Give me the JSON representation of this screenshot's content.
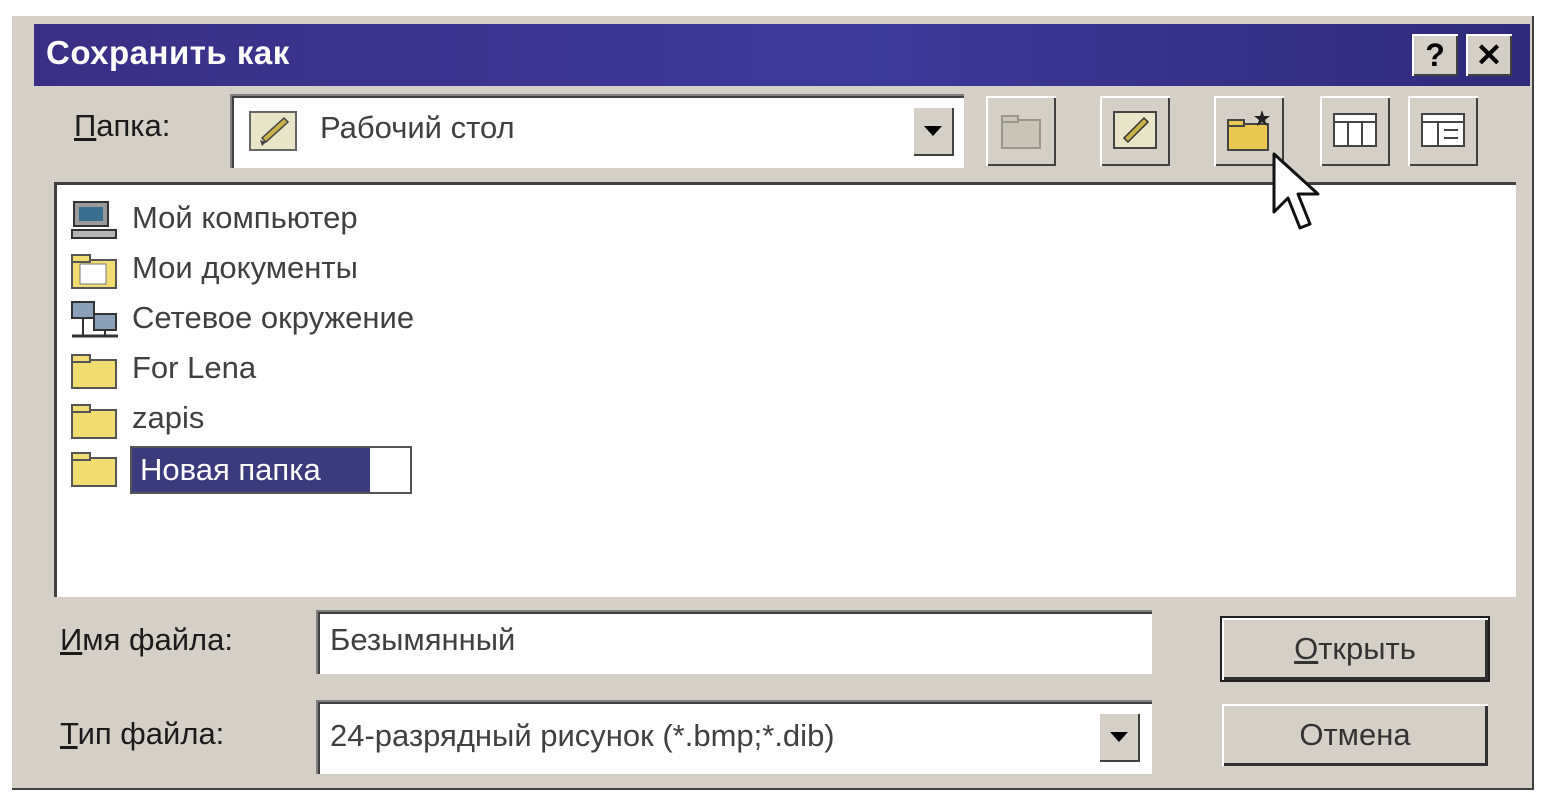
{
  "window": {
    "title": "Сохранить как",
    "help_glyph": "?",
    "close_glyph": "✕"
  },
  "folder": {
    "label_hotkey": "П",
    "label_rest": "апка:",
    "value": "Рабочий стол"
  },
  "files": [
    {
      "name": "Мой компьютер",
      "icon": "computer-icon"
    },
    {
      "name": "Мои документы",
      "icon": "folder-icon"
    },
    {
      "name": "Сетевое окружение",
      "icon": "network-icon"
    },
    {
      "name": "For Lena",
      "icon": "folder-icon"
    },
    {
      "name": "zapis",
      "icon": "folder-icon"
    },
    {
      "name": "Новая папка",
      "icon": "folder-icon",
      "editing": true
    }
  ],
  "filename": {
    "label_hotkey": "И",
    "label_rest": "мя файла:",
    "value": "Безымянный"
  },
  "filetype": {
    "label_hotkey": "Т",
    "label_rest": "ип файла:",
    "value": "24-разрядный рисунок (*.bmp;*.dib)"
  },
  "buttons": {
    "open_hotkey": "О",
    "open_rest": "ткрыть",
    "cancel": "Отмена"
  },
  "colors": {
    "titlebar": "#3a2f85",
    "selection": "#3b3a7d",
    "face": "#d4d0c8"
  }
}
